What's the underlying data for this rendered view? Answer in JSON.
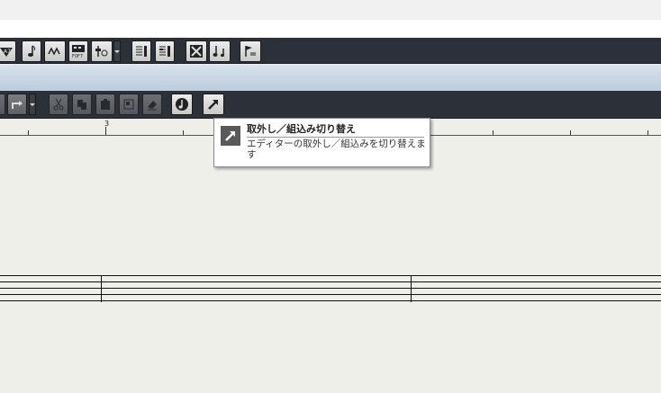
{
  "ruler": {
    "marker_label": "3"
  },
  "tooltip": {
    "title": "取外し／組込み切り替え",
    "description": "エディターの取外し／組込みを切り替えます"
  },
  "toolbar_top": {
    "buttons": [
      "auto-scroll",
      "quantize-note",
      "insert-velocity",
      "function-keys",
      "show-info",
      "step-input",
      "midi-input",
      "edit-mode",
      "layout-tool",
      "note-tool",
      "flag-tool"
    ]
  },
  "toolbar_edit": {
    "buttons": [
      "redo",
      "cut",
      "copy",
      "paste",
      "glue",
      "erase",
      "mute",
      "detach-attach"
    ]
  }
}
